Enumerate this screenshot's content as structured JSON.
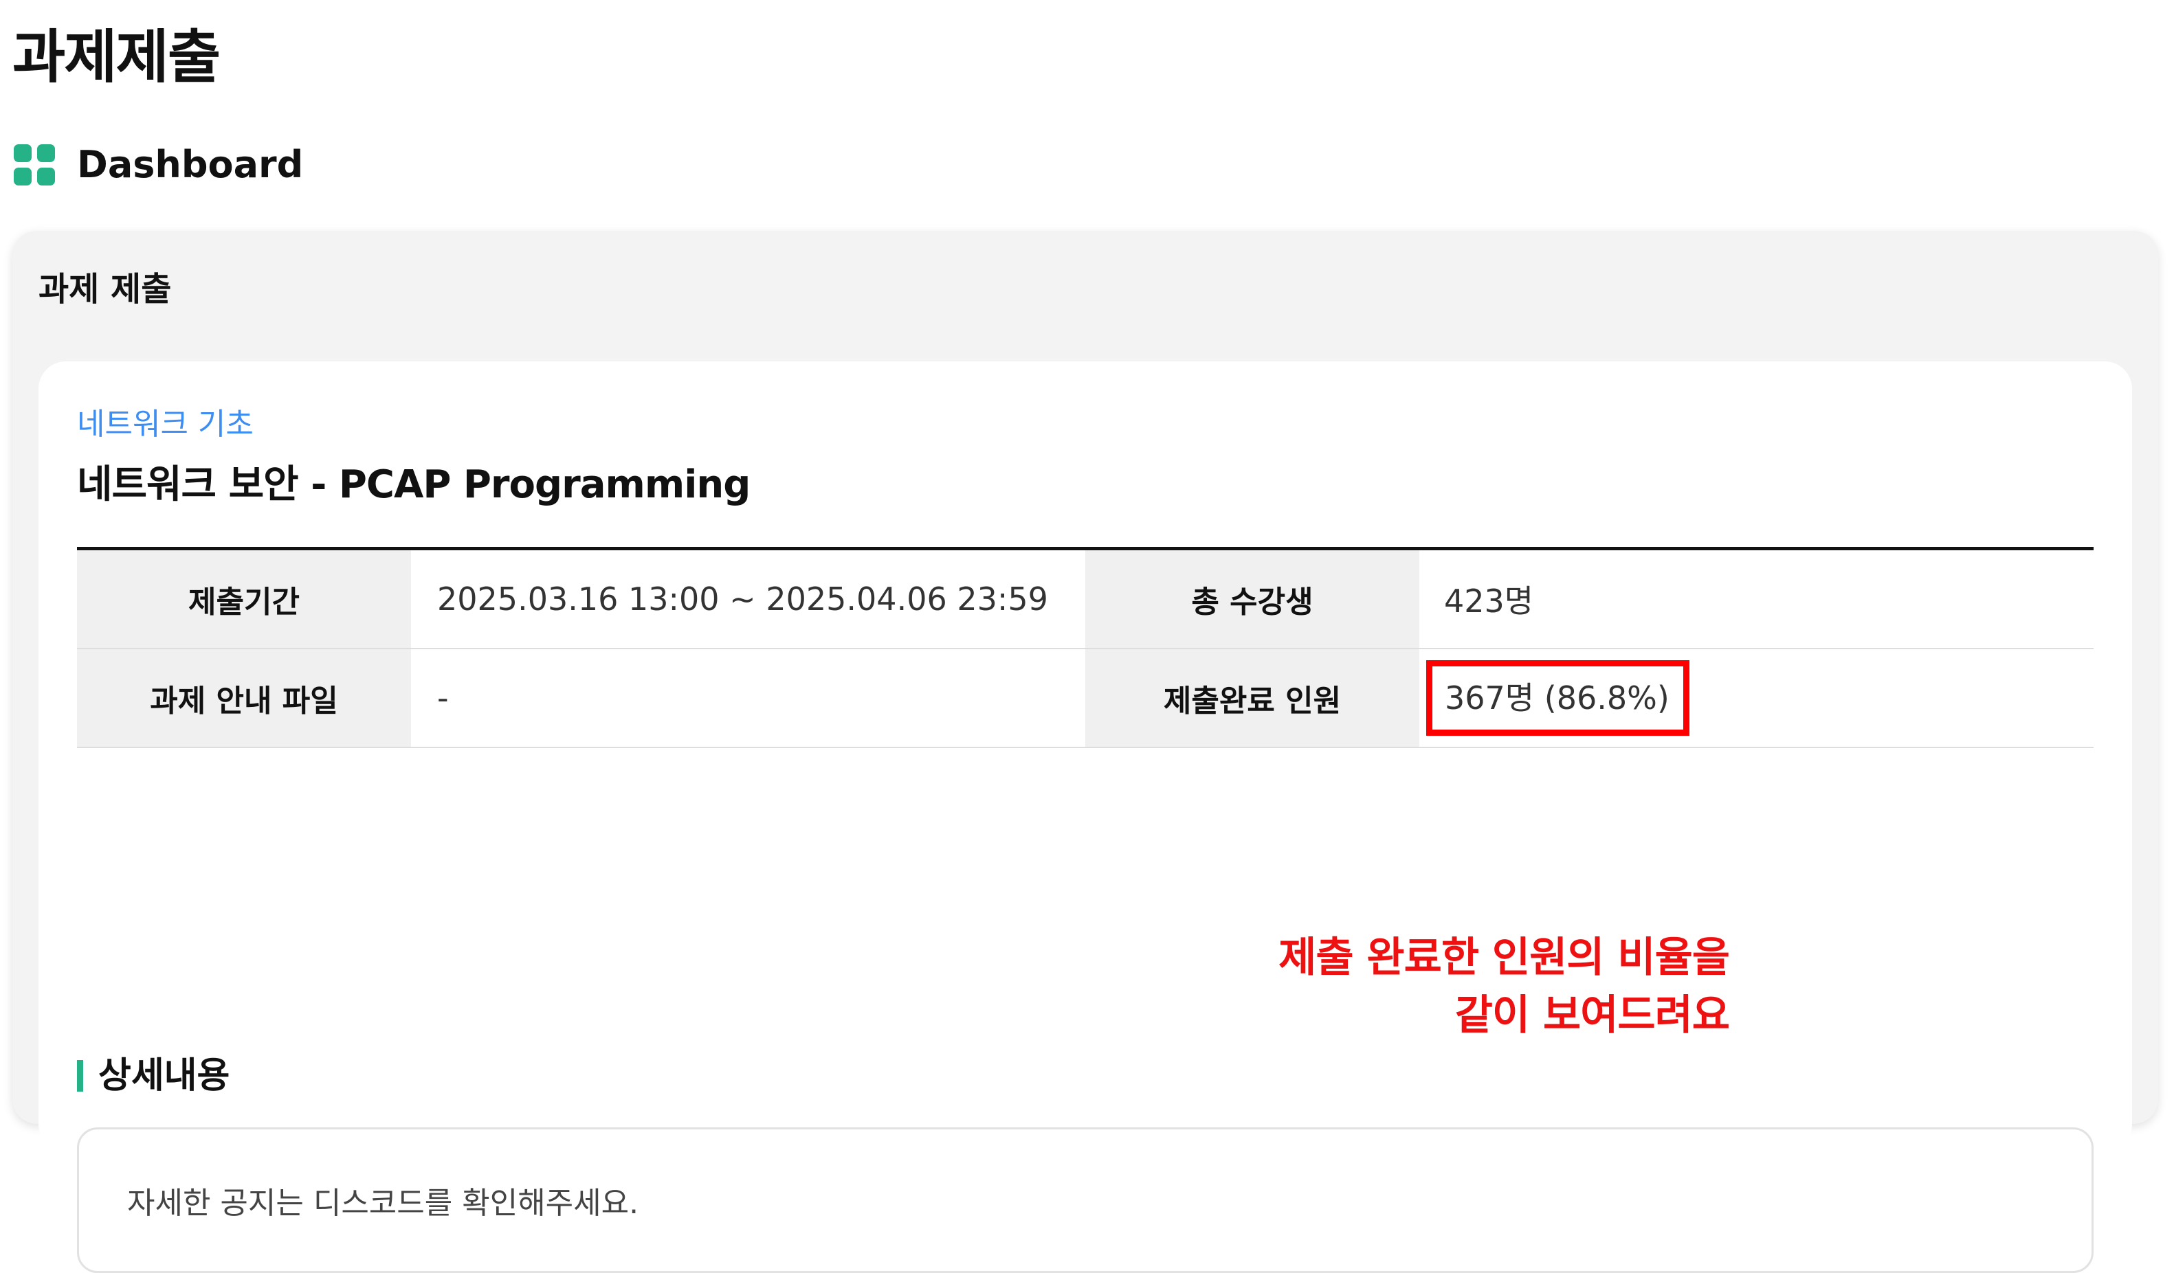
{
  "page": {
    "title": "과제제출",
    "dashboard_label": "Dashboard"
  },
  "card": {
    "title": "과제 제출",
    "course_name": "네트워크 기초",
    "assignment_title": "네트워크 보안 - PCAP Programming"
  },
  "info": {
    "period_label": "제출기간",
    "period_value": "2025.03.16 13:00 ~ 2025.04.06 23:59",
    "total_label": "총 수강생",
    "total_value": "423명",
    "file_label": "과제 안내 파일",
    "file_value": "-",
    "completed_label": "제출완료 인원",
    "completed_value": "367명 (86.8%)"
  },
  "annotation": {
    "line1": "제출 완료한 인원의 비율을",
    "line2": "같이 보여드려요",
    "color": "#ee1111"
  },
  "detail": {
    "heading": "상세내용",
    "text": "자세한 공지는 디스코드를 확인해주세요."
  },
  "colors": {
    "accent": "#26b287",
    "course_link": "#3d8ef0",
    "highlight_border": "#ff0000"
  },
  "icons": {
    "dashboard": "dashboard-grid-icon"
  }
}
